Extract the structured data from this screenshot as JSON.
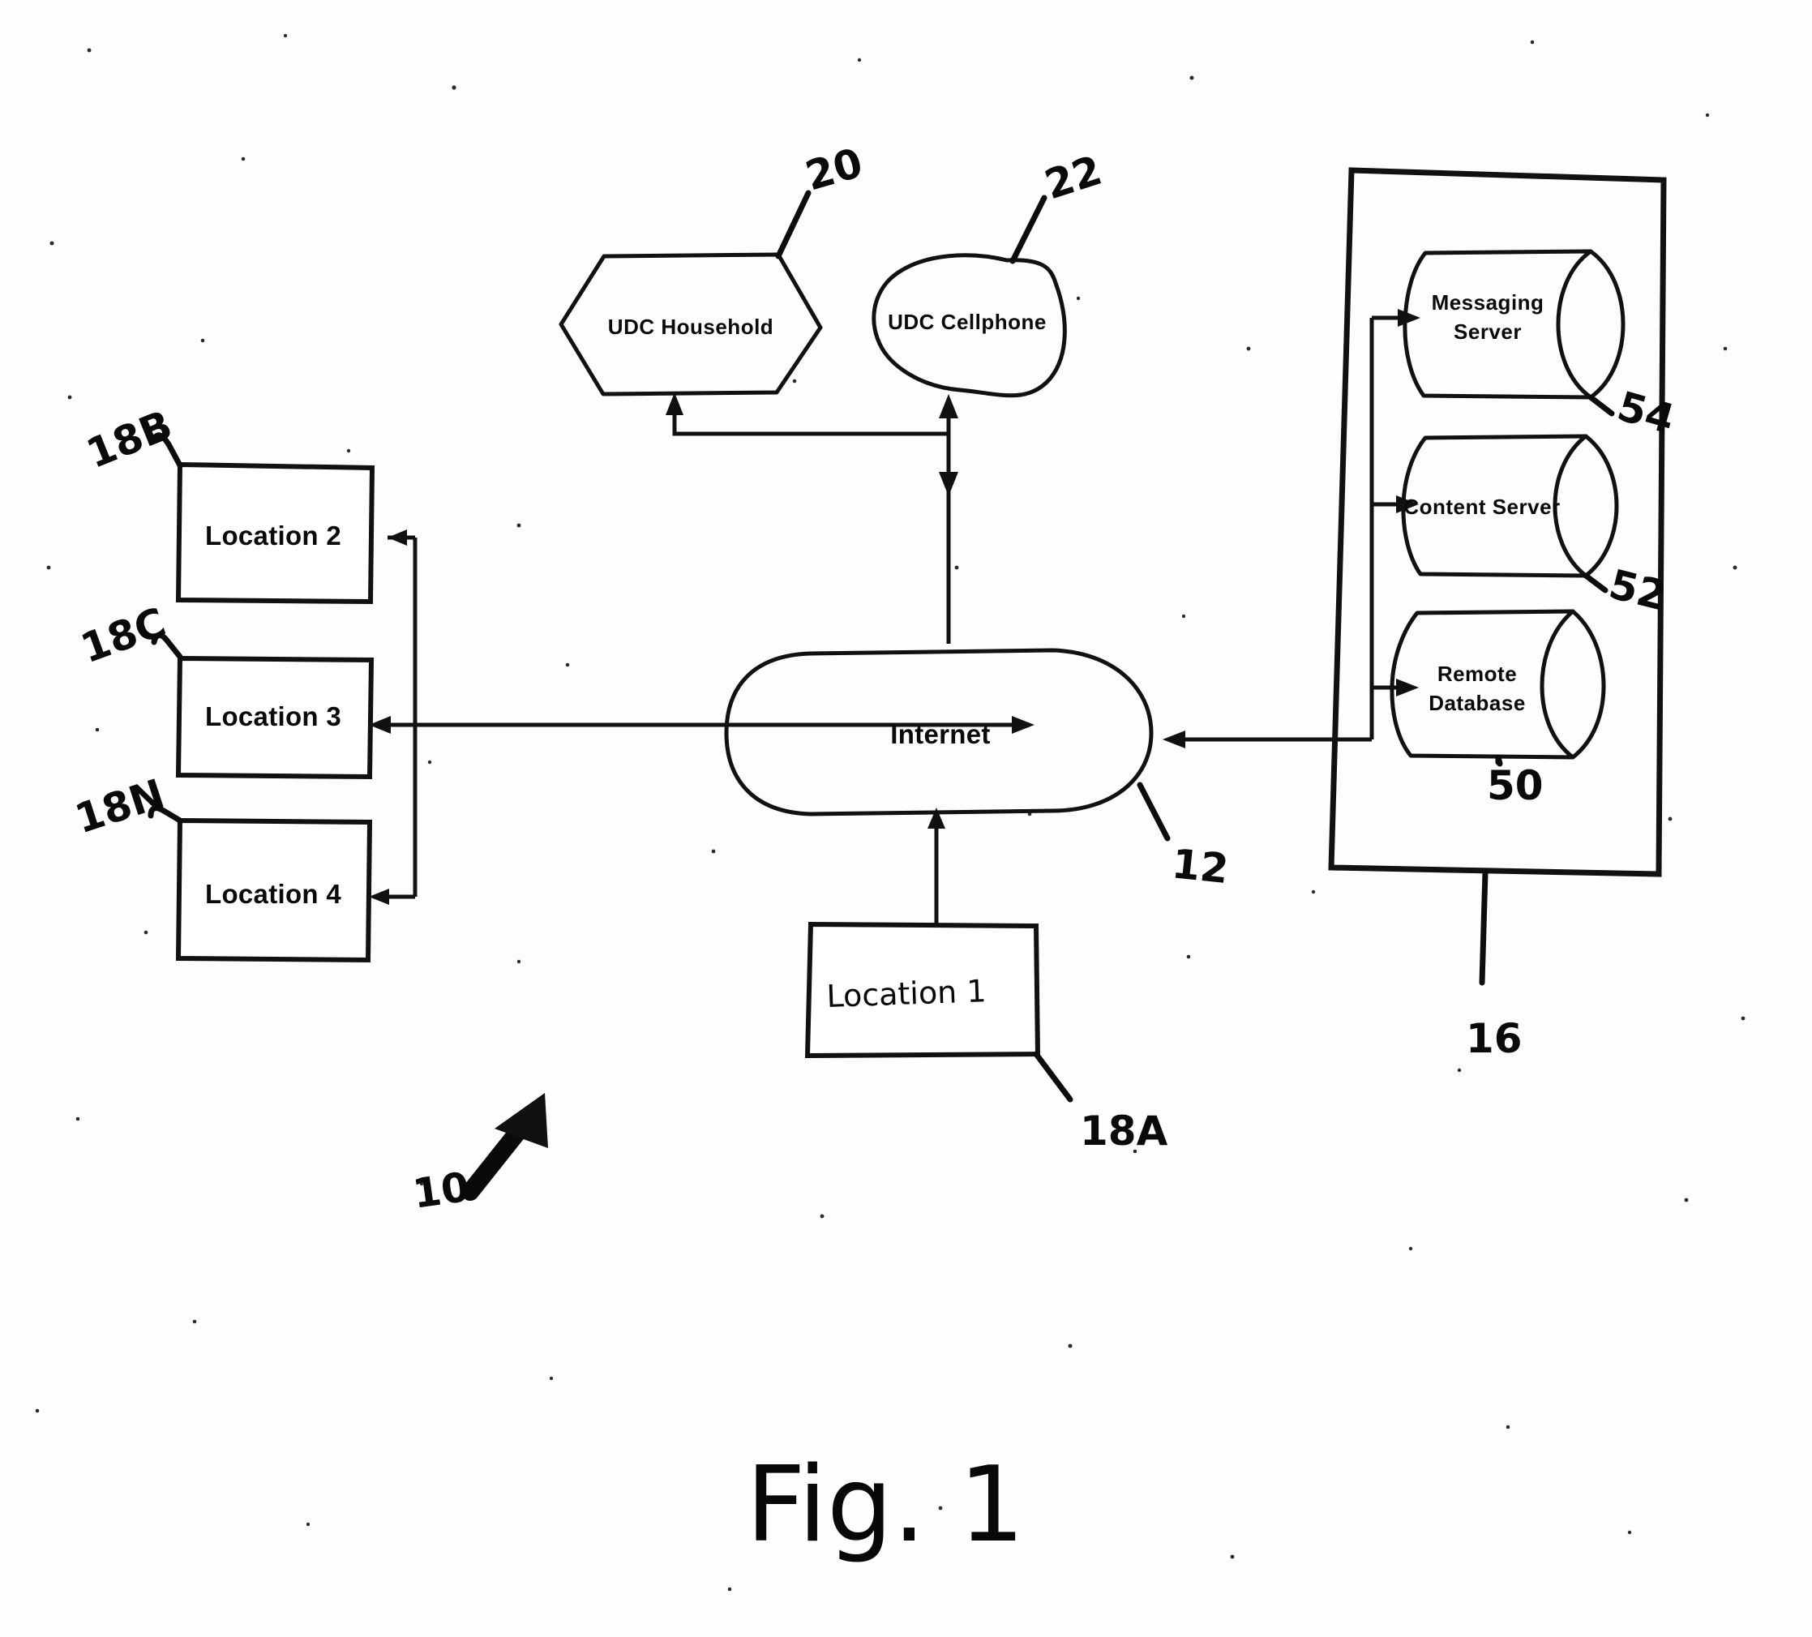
{
  "figure": {
    "caption": "Fig. 1",
    "system_ref": "10"
  },
  "nodes": {
    "udc_household": {
      "label": "UDC Household",
      "ref": "20",
      "shape": "hexagon"
    },
    "udc_cellphone": {
      "label": "UDC Cellphone",
      "ref": "22",
      "shape": "blob-oval"
    },
    "internet": {
      "label": "Internet",
      "ref": "12",
      "shape": "stadium"
    },
    "location1": {
      "label": "Location 1",
      "ref": "18A",
      "shape": "rectangle",
      "handwritten": true
    },
    "location2": {
      "label": "Location 2",
      "ref": "18B",
      "shape": "rectangle",
      "handwritten": false
    },
    "location3": {
      "label": "Location 3",
      "ref": "18C",
      "shape": "rectangle",
      "handwritten": false
    },
    "location4": {
      "label": "Location 4",
      "ref": "18N",
      "shape": "rectangle",
      "handwritten": false
    },
    "messaging_server": {
      "label_line1": "Messaging",
      "label_line2": "Server",
      "ref": "54",
      "shape": "cylinder"
    },
    "content_server": {
      "label_line1": "Content Server",
      "label_line2": "",
      "ref": "52",
      "shape": "cylinder"
    },
    "remote_database": {
      "label_line1": "Remote",
      "label_line2": "Database",
      "ref": "50",
      "shape": "cylinder"
    },
    "server_container": {
      "ref": "16",
      "shape": "rectangle"
    }
  },
  "colors": {
    "ink": "#111111",
    "paper": "#fdfdfd"
  }
}
